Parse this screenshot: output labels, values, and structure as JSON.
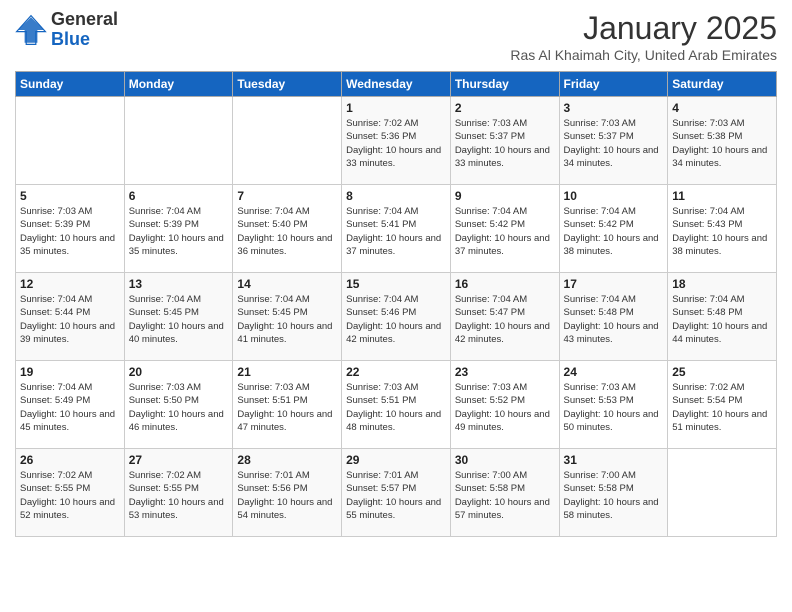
{
  "header": {
    "logo_general": "General",
    "logo_blue": "Blue",
    "month": "January 2025",
    "location": "Ras Al Khaimah City, United Arab Emirates"
  },
  "days_of_week": [
    "Sunday",
    "Monday",
    "Tuesday",
    "Wednesday",
    "Thursday",
    "Friday",
    "Saturday"
  ],
  "weeks": [
    [
      {
        "day": "",
        "sunrise": "",
        "sunset": "",
        "daylight": ""
      },
      {
        "day": "",
        "sunrise": "",
        "sunset": "",
        "daylight": ""
      },
      {
        "day": "",
        "sunrise": "",
        "sunset": "",
        "daylight": ""
      },
      {
        "day": "1",
        "sunrise": "7:02 AM",
        "sunset": "5:36 PM",
        "daylight": "10 hours and 33 minutes."
      },
      {
        "day": "2",
        "sunrise": "7:03 AM",
        "sunset": "5:37 PM",
        "daylight": "10 hours and 33 minutes."
      },
      {
        "day": "3",
        "sunrise": "7:03 AM",
        "sunset": "5:37 PM",
        "daylight": "10 hours and 34 minutes."
      },
      {
        "day": "4",
        "sunrise": "7:03 AM",
        "sunset": "5:38 PM",
        "daylight": "10 hours and 34 minutes."
      }
    ],
    [
      {
        "day": "5",
        "sunrise": "7:03 AM",
        "sunset": "5:39 PM",
        "daylight": "10 hours and 35 minutes."
      },
      {
        "day": "6",
        "sunrise": "7:04 AM",
        "sunset": "5:39 PM",
        "daylight": "10 hours and 35 minutes."
      },
      {
        "day": "7",
        "sunrise": "7:04 AM",
        "sunset": "5:40 PM",
        "daylight": "10 hours and 36 minutes."
      },
      {
        "day": "8",
        "sunrise": "7:04 AM",
        "sunset": "5:41 PM",
        "daylight": "10 hours and 37 minutes."
      },
      {
        "day": "9",
        "sunrise": "7:04 AM",
        "sunset": "5:42 PM",
        "daylight": "10 hours and 37 minutes."
      },
      {
        "day": "10",
        "sunrise": "7:04 AM",
        "sunset": "5:42 PM",
        "daylight": "10 hours and 38 minutes."
      },
      {
        "day": "11",
        "sunrise": "7:04 AM",
        "sunset": "5:43 PM",
        "daylight": "10 hours and 38 minutes."
      }
    ],
    [
      {
        "day": "12",
        "sunrise": "7:04 AM",
        "sunset": "5:44 PM",
        "daylight": "10 hours and 39 minutes."
      },
      {
        "day": "13",
        "sunrise": "7:04 AM",
        "sunset": "5:45 PM",
        "daylight": "10 hours and 40 minutes."
      },
      {
        "day": "14",
        "sunrise": "7:04 AM",
        "sunset": "5:45 PM",
        "daylight": "10 hours and 41 minutes."
      },
      {
        "day": "15",
        "sunrise": "7:04 AM",
        "sunset": "5:46 PM",
        "daylight": "10 hours and 42 minutes."
      },
      {
        "day": "16",
        "sunrise": "7:04 AM",
        "sunset": "5:47 PM",
        "daylight": "10 hours and 42 minutes."
      },
      {
        "day": "17",
        "sunrise": "7:04 AM",
        "sunset": "5:48 PM",
        "daylight": "10 hours and 43 minutes."
      },
      {
        "day": "18",
        "sunrise": "7:04 AM",
        "sunset": "5:48 PM",
        "daylight": "10 hours and 44 minutes."
      }
    ],
    [
      {
        "day": "19",
        "sunrise": "7:04 AM",
        "sunset": "5:49 PM",
        "daylight": "10 hours and 45 minutes."
      },
      {
        "day": "20",
        "sunrise": "7:03 AM",
        "sunset": "5:50 PM",
        "daylight": "10 hours and 46 minutes."
      },
      {
        "day": "21",
        "sunrise": "7:03 AM",
        "sunset": "5:51 PM",
        "daylight": "10 hours and 47 minutes."
      },
      {
        "day": "22",
        "sunrise": "7:03 AM",
        "sunset": "5:51 PM",
        "daylight": "10 hours and 48 minutes."
      },
      {
        "day": "23",
        "sunrise": "7:03 AM",
        "sunset": "5:52 PM",
        "daylight": "10 hours and 49 minutes."
      },
      {
        "day": "24",
        "sunrise": "7:03 AM",
        "sunset": "5:53 PM",
        "daylight": "10 hours and 50 minutes."
      },
      {
        "day": "25",
        "sunrise": "7:02 AM",
        "sunset": "5:54 PM",
        "daylight": "10 hours and 51 minutes."
      }
    ],
    [
      {
        "day": "26",
        "sunrise": "7:02 AM",
        "sunset": "5:55 PM",
        "daylight": "10 hours and 52 minutes."
      },
      {
        "day": "27",
        "sunrise": "7:02 AM",
        "sunset": "5:55 PM",
        "daylight": "10 hours and 53 minutes."
      },
      {
        "day": "28",
        "sunrise": "7:01 AM",
        "sunset": "5:56 PM",
        "daylight": "10 hours and 54 minutes."
      },
      {
        "day": "29",
        "sunrise": "7:01 AM",
        "sunset": "5:57 PM",
        "daylight": "10 hours and 55 minutes."
      },
      {
        "day": "30",
        "sunrise": "7:00 AM",
        "sunset": "5:58 PM",
        "daylight": "10 hours and 57 minutes."
      },
      {
        "day": "31",
        "sunrise": "7:00 AM",
        "sunset": "5:58 PM",
        "daylight": "10 hours and 58 minutes."
      },
      {
        "day": "",
        "sunrise": "",
        "sunset": "",
        "daylight": ""
      }
    ]
  ],
  "labels": {
    "sunrise": "Sunrise:",
    "sunset": "Sunset:",
    "daylight": "Daylight:"
  }
}
